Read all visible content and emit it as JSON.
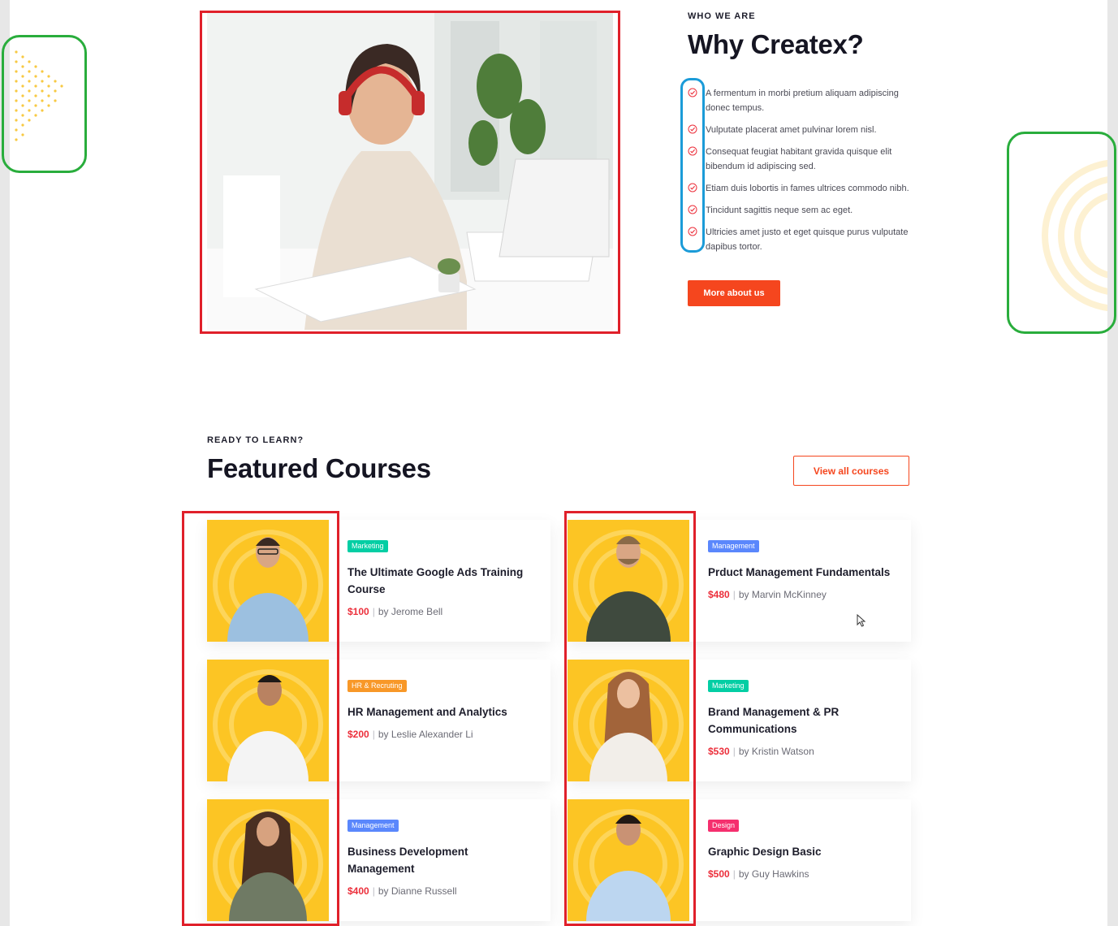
{
  "why": {
    "eyebrow": "WHO WE ARE",
    "title": "Why Createx?",
    "features": [
      "A fermentum in morbi pretium aliquam adipiscing donec tempus.",
      "Vulputate placerat amet pulvinar lorem nisl.",
      "Consequat feugiat habitant gravida quisque elit bibendum id adipiscing sed.",
      "Etiam duis lobortis in fames ultrices commodo nibh.",
      "Tincidunt sagittis neque sem ac eget.",
      "Ultricies amet justo et eget quisque purus vulputate dapibus tortor."
    ],
    "button": "More about us"
  },
  "courses": {
    "eyebrow": "READY TO LEARN?",
    "title": "Featured Courses",
    "view_all": "View all courses",
    "items": [
      {
        "tag": "Marketing",
        "tag_color": "#03cea4",
        "title": "The Ultimate Google Ads Training Course",
        "price": "$100",
        "author": "by Jerome Bell"
      },
      {
        "tag": "Management",
        "tag_color": "#5a87fc",
        "title": "Prduct Management Fundamentals",
        "price": "$480",
        "author": "by Marvin McKinney"
      },
      {
        "tag": "HR & Recruting",
        "tag_color": "#f89828",
        "title": "HR  Management and Analytics",
        "price": "$200",
        "author": "by Leslie Alexander Li"
      },
      {
        "tag": "Marketing",
        "tag_color": "#03cea4",
        "title": "Brand Management & PR Communications",
        "price": "$530",
        "author": "by Kristin Watson"
      },
      {
        "tag": "Management",
        "tag_color": "#5a87fc",
        "title": "Business Development Management",
        "price": "$400",
        "author": "by Dianne Russell"
      },
      {
        "tag": "Design",
        "tag_color": "#f52f6e",
        "title": "Graphic Design Basic",
        "price": "$500",
        "author": "by Guy Hawkins"
      }
    ]
  },
  "colors": {
    "accent": "#f5461e",
    "price": "#ec2f3b",
    "card_image_bg": "#fcc524"
  },
  "icons": [
    "check-circle-icon",
    "mouse-cursor-icon"
  ]
}
